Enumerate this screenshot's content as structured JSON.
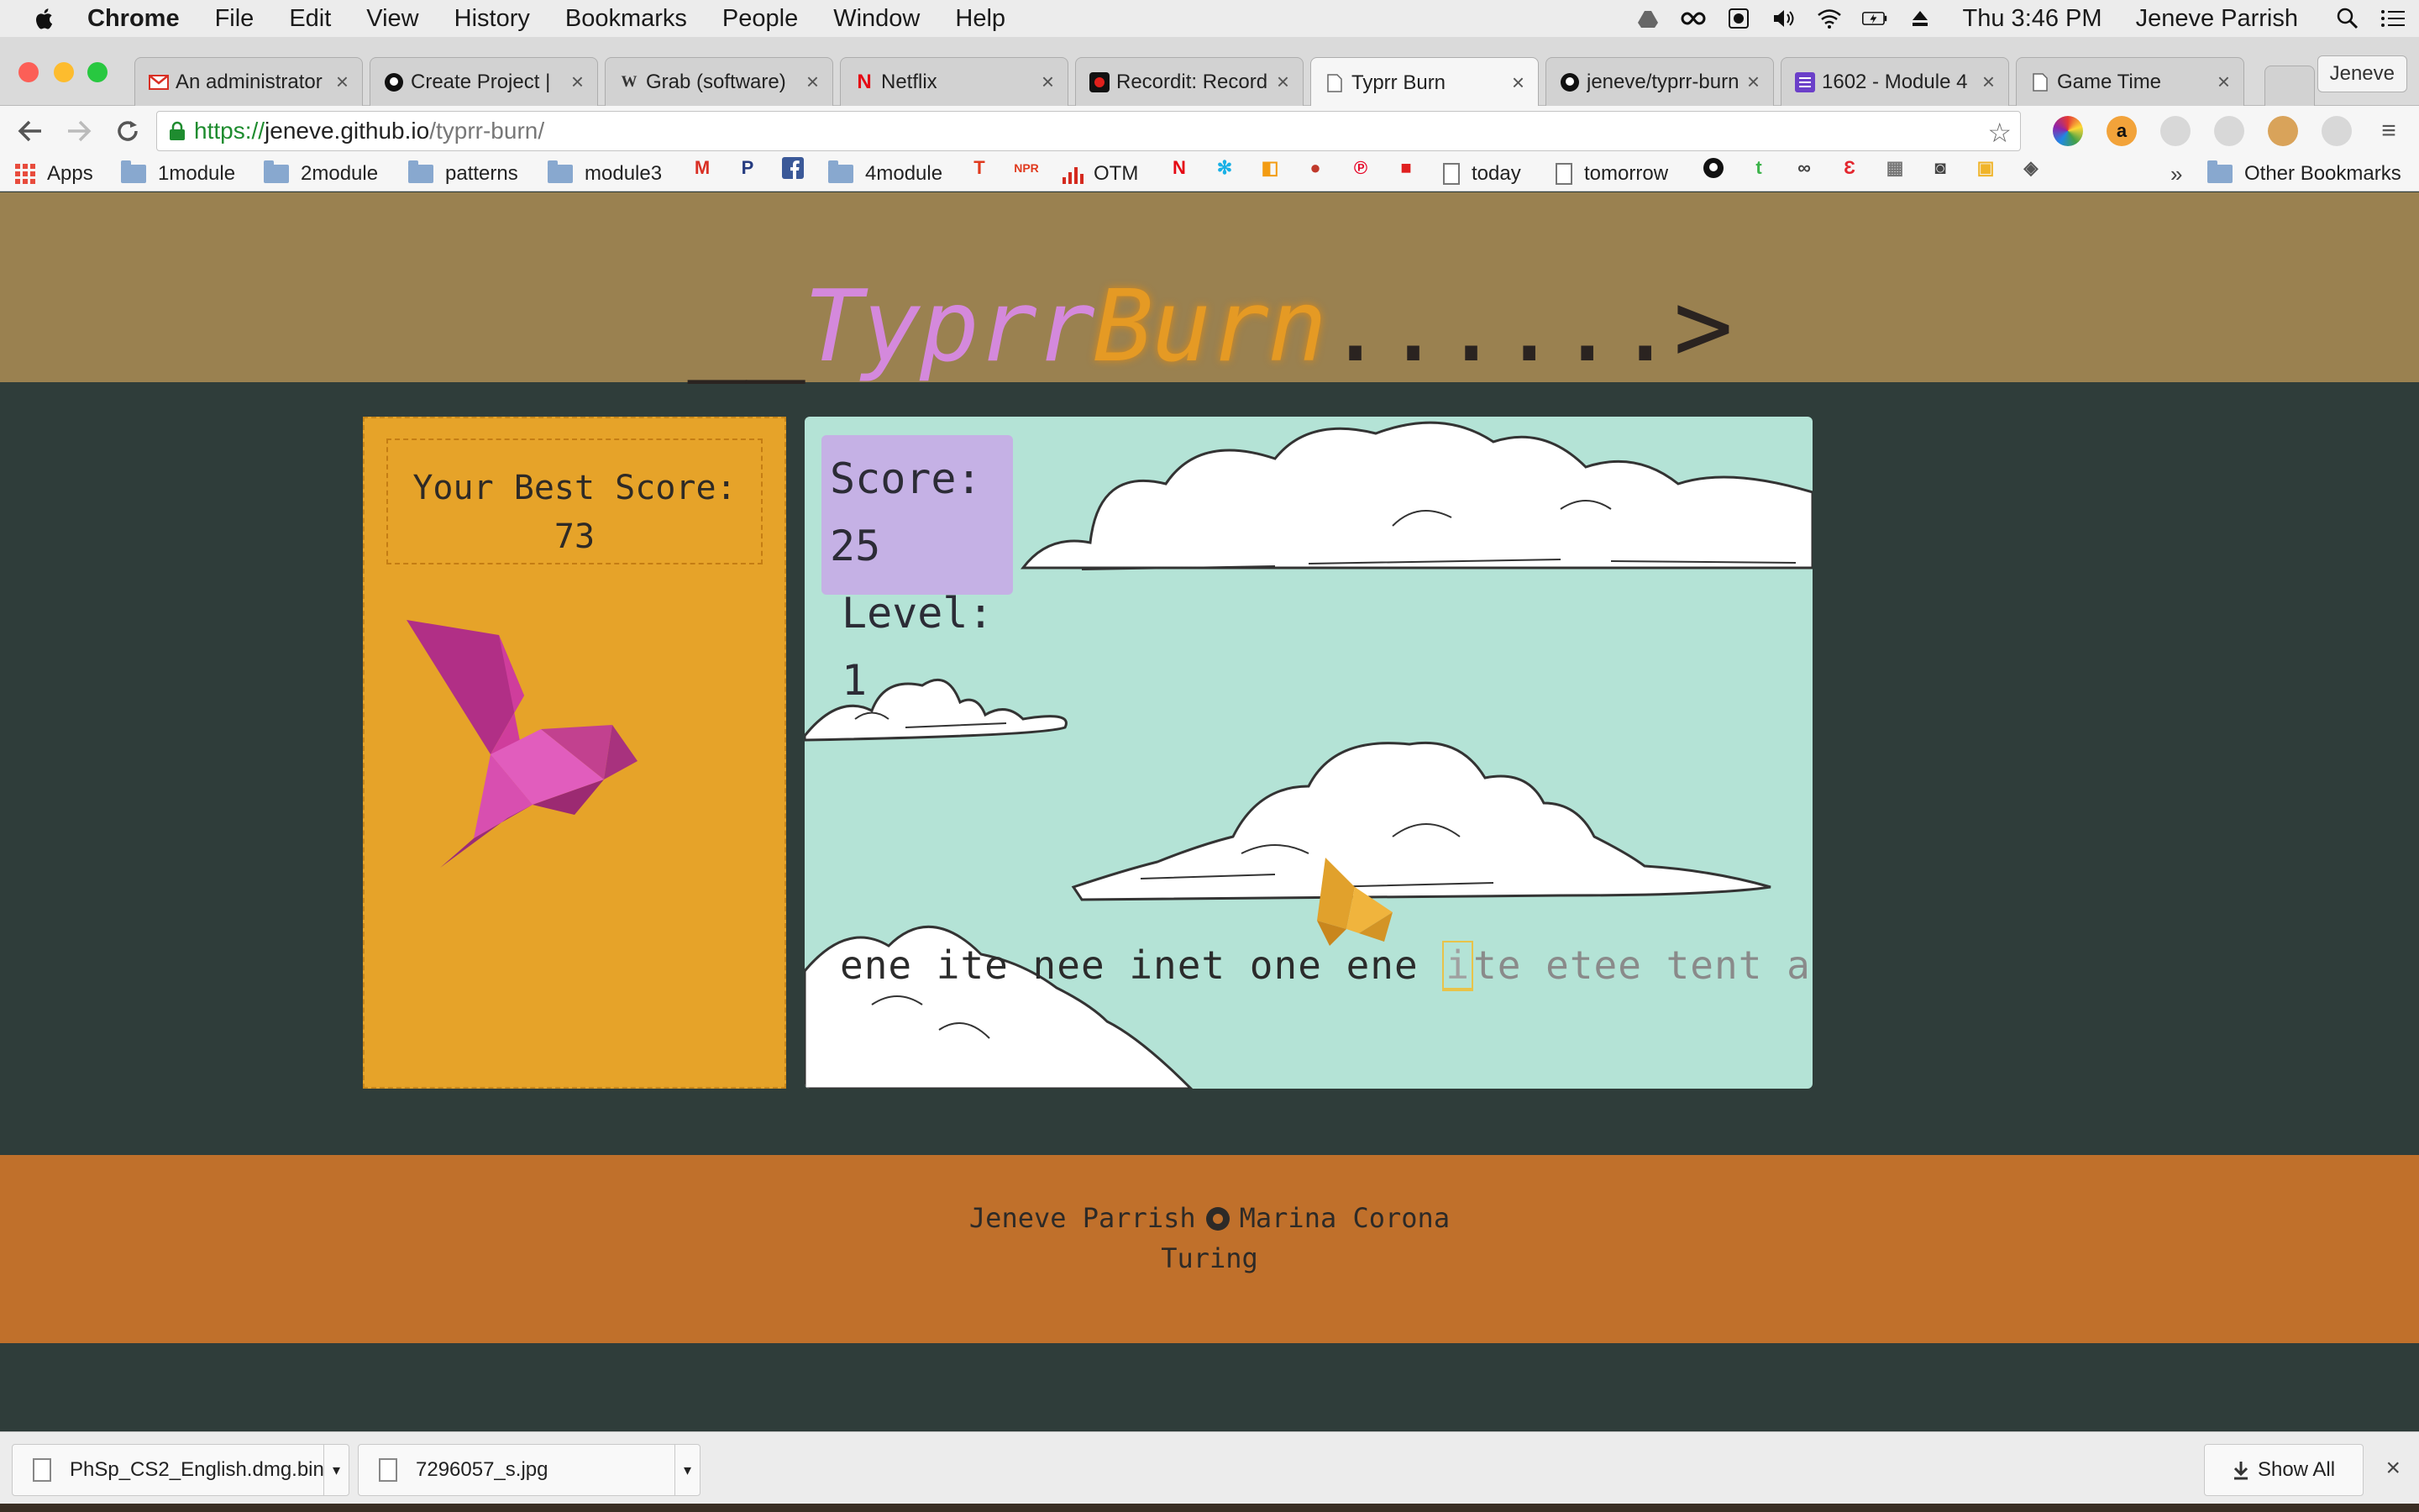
{
  "menubar": {
    "app_name": "Chrome",
    "menus": [
      "File",
      "Edit",
      "View",
      "History",
      "Bookmarks",
      "People",
      "Window",
      "Help"
    ],
    "clock": "Thu 3:46 PM",
    "user": "Jeneve Parrish"
  },
  "tabs": [
    {
      "label": "An administrator",
      "icon": "gmail-icon",
      "color": "#d93025"
    },
    {
      "label": "Create Project |",
      "icon": "github-icon",
      "color": "#111111"
    },
    {
      "label": "Grab (software)",
      "icon": "wikipedia-icon",
      "color": "#333333"
    },
    {
      "label": "Netflix",
      "icon": "netflix-icon",
      "color": "#e50914"
    },
    {
      "label": "Recordit: Record",
      "icon": "recordit-icon",
      "color": "#e0201c"
    },
    {
      "label": "Typrr Burn",
      "icon": "page-icon",
      "color": "#777777"
    },
    {
      "label": "jeneve/typrr-burn",
      "icon": "github-icon",
      "color": "#111111"
    },
    {
      "label": "1602 - Module 4",
      "icon": "list-icon",
      "color": "#6b3fc9"
    },
    {
      "label": "Game Time",
      "icon": "page-icon",
      "color": "#777777"
    }
  ],
  "profile_name": "Jeneve",
  "address": {
    "scheme": "https://",
    "host": "jeneve.github.io",
    "path": "/typrr-burn/"
  },
  "bookmarks": {
    "apps": "Apps",
    "items": [
      "1module",
      "2module",
      "patterns",
      "module3",
      "4module",
      "OTM",
      "today",
      "tomorrow"
    ],
    "overflow": "»",
    "other": "Other Bookmarks"
  },
  "page": {
    "logo": {
      "prefix": "__",
      "typrr": "Typrr",
      "burn": "Burn",
      "suffix": "......>"
    },
    "best_score_label": "Your Best Score:",
    "best_score_value": "73",
    "score_text": "Score: 25",
    "level_text": "Level: 1",
    "words_typed": "ene ite nee inet one ene ",
    "cursor_char": "i",
    "words_remaining": "te etee tent at",
    "footer_author1": "Jeneve Parrish",
    "footer_author2": "Marina Corona",
    "footer_org": "Turing"
  },
  "downloads": {
    "items": [
      "PhSp_CS2_English.dmg.bin",
      "7296057_s.jpg"
    ],
    "show_all": "Show All"
  },
  "colors": {
    "header": "#9a8150",
    "background": "#2f3d3a",
    "side_panel": "#e6a329",
    "sky": "#b4e3d6",
    "footer": "#c0702b",
    "logo_typrr": "#d489dc",
    "logo_burn": "#e59a24"
  }
}
